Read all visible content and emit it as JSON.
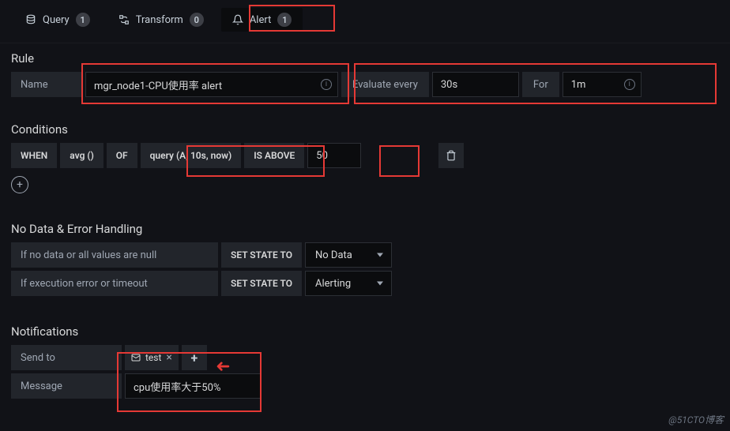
{
  "tabs": {
    "query": {
      "label": "Query",
      "count": "1"
    },
    "transform": {
      "label": "Transform",
      "count": "0"
    },
    "alert": {
      "label": "Alert",
      "count": "1"
    }
  },
  "rule": {
    "title": "Rule",
    "nameLabel": "Name",
    "nameValue": "mgr_node1-CPU使用率 alert",
    "evalLabel": "Evaluate every",
    "evalValue": "30s",
    "forLabel": "For",
    "forValue": "1m"
  },
  "conditions": {
    "title": "Conditions",
    "when": "WHEN",
    "agg": "avg ()",
    "of": "OF",
    "query": "query (A, 10s, now)",
    "isAbove": "IS ABOVE",
    "threshold": "50"
  },
  "errorHandling": {
    "title": "No Data & Error Handling",
    "noDataLabel": "If no data or all values are null",
    "noDataState": "No Data",
    "execErrLabel": "If execution error or timeout",
    "execErrState": "Alerting",
    "setState": "SET STATE TO"
  },
  "notifications": {
    "title": "Notifications",
    "sendToLabel": "Send to",
    "channel": "test",
    "messageLabel": "Message",
    "messageValue": "cpu使用率大于50%"
  },
  "watermark": "@51CTO博客"
}
